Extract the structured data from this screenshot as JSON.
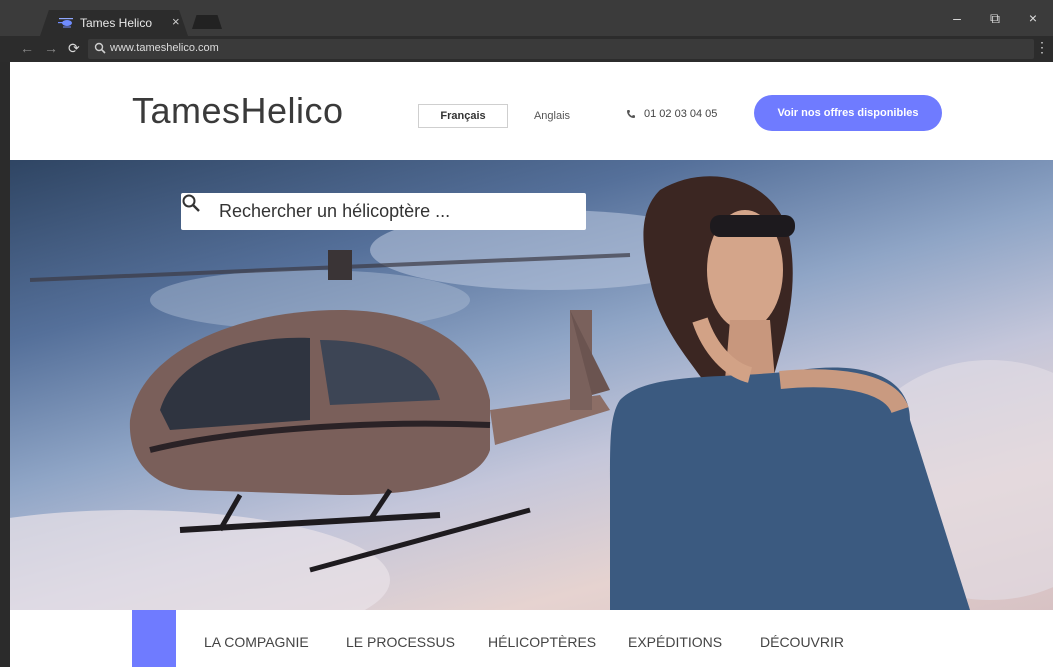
{
  "browser": {
    "tab_title": "Tames Helico",
    "tab_close": "×",
    "url": "www.tameshelico.com",
    "window_controls": {
      "minimize": "–",
      "restore": "⧉",
      "close": "×"
    },
    "menu": "⋮"
  },
  "header": {
    "logo": "TamesHelico",
    "lang_active": "Français",
    "lang_other": "Anglais",
    "phone": "01 02 03 04 05",
    "cta": "Voir nos offres disponibles"
  },
  "hero": {
    "search_placeholder": "Rechercher un hélicoptère ..."
  },
  "nav": {
    "items": [
      "LA COMPAGNIE",
      "LE PROCESSUS",
      "HÉLICOPTÈRES",
      "EXPÉDITIONS",
      "DÉCOUVRIR"
    ]
  },
  "colors": {
    "accent": "#6f7bff",
    "chrome_dark": "#2c2c2c"
  }
}
